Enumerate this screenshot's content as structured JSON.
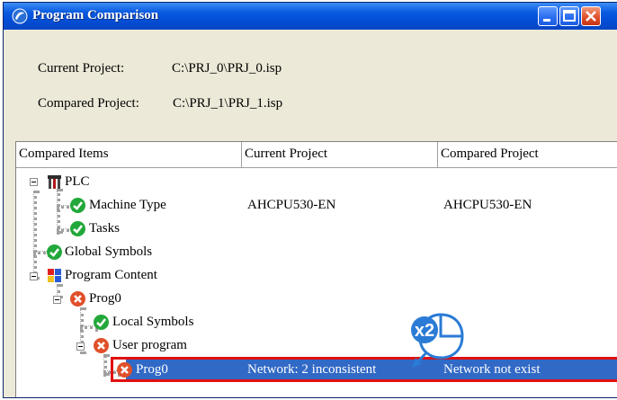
{
  "window": {
    "title": "Program Comparison"
  },
  "current_project": {
    "label": "Current Project:",
    "path": "C:\\PRJ_0\\PRJ_0.isp"
  },
  "compared_project": {
    "label": "Compared Project:",
    "path": "C:\\PRJ_1\\PRJ_1.isp"
  },
  "columns": [
    "Compared Items",
    "Current Project",
    "Compared Project"
  ],
  "tree": {
    "plc": "PLC",
    "machine_type": {
      "label": "Machine Type",
      "current": "AHCPU530-EN",
      "compared": "AHCPU530-EN"
    },
    "tasks": "Tasks",
    "global_symbols": "Global Symbols",
    "program_content": "Program Content",
    "prog0": "Prog0",
    "local_symbols": "Local Symbols",
    "user_program": "User program",
    "prog0_item": {
      "label": "Prog0",
      "current": "Network: 2 inconsistent",
      "compared": "Network not exist"
    }
  },
  "callout": {
    "text": "x2",
    "icon": "mouse-double-click-icon"
  },
  "colors": {
    "title_bar": "#0a5be0",
    "selection": "#3169c6",
    "highlight_box": "#e01010",
    "ok": "#22a83a",
    "error": "#e0502a"
  }
}
